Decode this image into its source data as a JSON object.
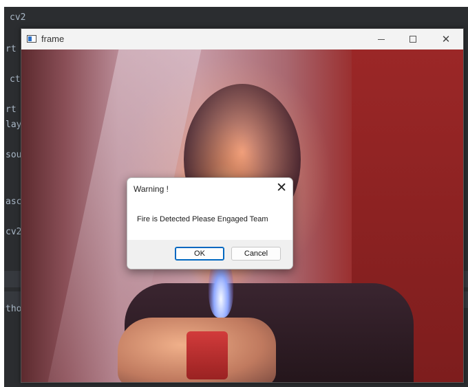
{
  "ide": {
    "lines": [
      "cv2",
      "rt",
      "ct",
      "rt",
      "lay",
      "sou",
      "asc",
      "cv2",
      "thor"
    ]
  },
  "window": {
    "title": "frame",
    "close_glyph": "✕"
  },
  "dialog": {
    "title": "Warning !",
    "close_glyph": "✕",
    "message": "Fire is Detected Please Engaged Team",
    "ok_label": "OK",
    "cancel_label": "Cancel"
  }
}
